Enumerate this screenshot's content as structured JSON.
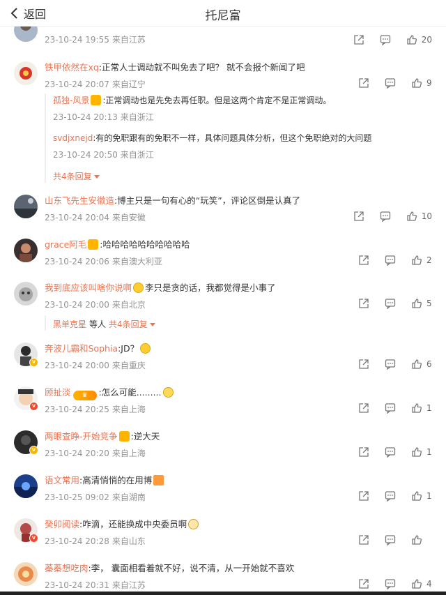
{
  "header": {
    "back_label": "返回",
    "title": "托尼富"
  },
  "comments": [
    {
      "user": "",
      "text": "",
      "time": "23-10-24 19:55",
      "loc": "来自江苏",
      "likes": "20"
    },
    {
      "user": "铁甲依然在xq",
      "text": ":正常人士调动就不叫免去了吧？ 就不会报个新闻了吧",
      "time": "23-10-24 20:07",
      "loc": "来自辽宁",
      "likes": "9"
    },
    {
      "user": "山东飞先生安徽造",
      "text": ":博主只是一句有心的“玩笑”，评论区倒是认真了",
      "time": "23-10-24 20:04",
      "loc": "来自安徽",
      "likes": "10"
    },
    {
      "user": "grace阿毛",
      "text": ":哈哈哈哈哈哈哈哈哈哈",
      "time": "23-10-24 20:06",
      "loc": "来自澳大利亚",
      "likes": "2"
    },
    {
      "user": "我到底应该叫啥你说啊",
      "text": "李只是贪的话，我都觉得是小事了",
      "time": "23-10-24 20:00",
      "loc": "来自北京",
      "likes": "5"
    },
    {
      "user": "奔波儿霸和Sophia",
      "text": ":JD？",
      "time": "23-10-24 20:00",
      "loc": "来自重庆",
      "likes": "6"
    },
    {
      "user": "顾扯淡",
      "text": ":怎么可能.........",
      "time": "23-10-24 20:25",
      "loc": "来自上海",
      "likes": "1"
    },
    {
      "user": "两眼查睁-开始竞争",
      "text": ":逆大天",
      "time": "23-10-24 20:20",
      "loc": "来自上海",
      "likes": "1"
    },
    {
      "user": "语文常用",
      "text": ":高清悄悄的在用博",
      "time": "23-10-25 09:02",
      "loc": "来自湖南",
      "likes": "1"
    },
    {
      "user": "癸卯阅读",
      "text": ":咋滴，还能换成中央委员啊",
      "time": "23-10-24 20:28",
      "loc": "来自山东",
      "likes": ""
    },
    {
      "user": "蓁蓁想吃肉",
      "text": ":李，  囊面相看着就不好，说不清，从一开始就不喜欢",
      "time": "23-10-24 20:31",
      "loc": "来自江苏",
      "likes": "4"
    }
  ],
  "replies": [
    {
      "user": "孤独-风景",
      "text": ":正常调动也是先免去再任职。但是这两个肯定不是正常调动。",
      "time": "23-10-24 20:13",
      "loc": "来自浙江"
    },
    {
      "user": "svdjxnejd",
      "text": ":有的免职跟有的免职不一样，具体问题具体分析，但这个免职绝对的大问题",
      "time": "23-10-24 20:50",
      "loc": "来自浙江"
    }
  ],
  "more_replies_1": "共4条回复",
  "more_replies_2": {
    "user": "黑单克星",
    "mid": "等人",
    "label": "共4条回复"
  },
  "colors": {
    "username": "#eb7350",
    "meta": "#939393"
  }
}
